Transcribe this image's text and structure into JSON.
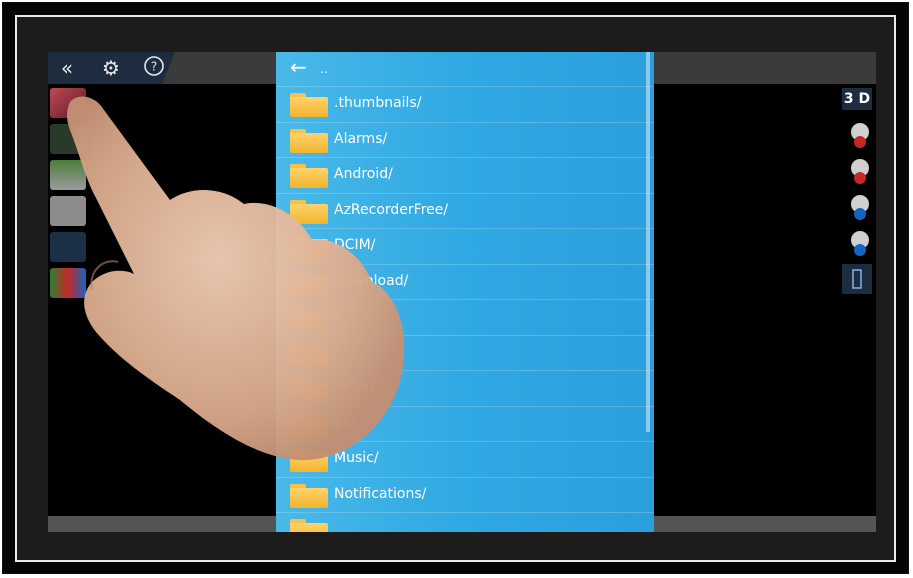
{
  "toolbar": {
    "icons": [
      "double-chevron-left-icon",
      "gears-icon",
      "help-icon"
    ],
    "three_d_label": "3 D"
  },
  "file_browser": {
    "back_arrow": "←",
    "current_path": "..",
    "items": [
      {
        "name": ".thumbnails/"
      },
      {
        "name": "Alarms/"
      },
      {
        "name": "Android/"
      },
      {
        "name": "AzRecorderFree/"
      },
      {
        "name": "DCIM/"
      },
      {
        "name": "Download/"
      },
      {
        "name": "/"
      },
      {
        "name": ""
      },
      {
        "name": "raser/"
      },
      {
        "name": "es/"
      },
      {
        "name": "Music/"
      },
      {
        "name": "Notifications/"
      },
      {
        "name": ""
      }
    ]
  },
  "colors": {
    "sheet": "#30a8e2",
    "folder": "#f7c247",
    "toolbar": "#1d2c3f"
  }
}
